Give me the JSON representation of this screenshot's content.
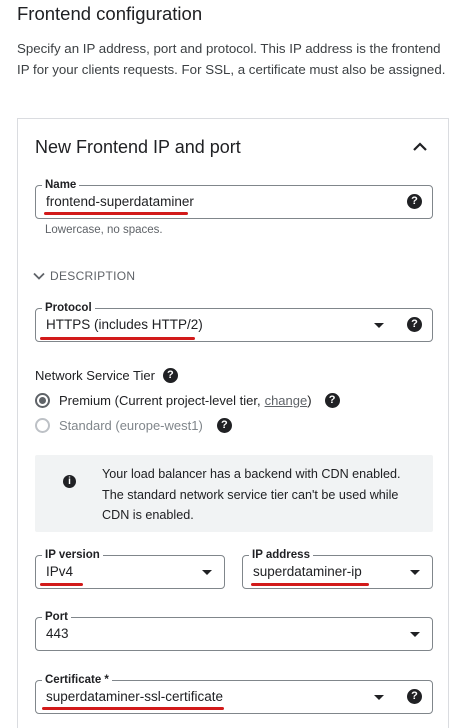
{
  "page": {
    "title": "Frontend configuration",
    "description": "Specify an IP address, port and protocol. This IP address is the frontend IP for your clients requests. For SSL, a certificate must also be assigned."
  },
  "card": {
    "title": "New Frontend IP and port",
    "collapse_icon": "chevron-up-icon"
  },
  "name_field": {
    "label": "Name",
    "value": "frontend-superdataminer",
    "hint": "Lowercase, no spaces.",
    "help_icon": "help-icon"
  },
  "description_toggle": {
    "label": "DESCRIPTION",
    "icon": "chevron-down-icon"
  },
  "protocol_field": {
    "label": "Protocol",
    "value": "HTTPS (includes HTTP/2)"
  },
  "network_tier": {
    "label": "Network Service Tier",
    "options": [
      {
        "label": "Premium (Current project-level tier,",
        "link": "change",
        "suffix": ")",
        "checked": true,
        "disabled": false
      },
      {
        "label": "Standard (europe-west1)",
        "checked": false,
        "disabled": true
      }
    ]
  },
  "info": {
    "icon": "info-icon",
    "text": "Your load balancer has a backend with CDN enabled. The standard network service tier can't be used while CDN is enabled."
  },
  "ip_version_field": {
    "label": "IP version",
    "value": "IPv4"
  },
  "ip_address_field": {
    "label": "IP address",
    "value": "superdataminer-ip"
  },
  "port_field": {
    "label": "Port",
    "value": "443"
  },
  "certificate_field": {
    "label": "Certificate *",
    "value": "superdataminer-ssl-certificate"
  },
  "colors": {
    "annotation_underline": "#d21a1a",
    "border": "#dadce0",
    "info_background": "#f1f3f4"
  }
}
